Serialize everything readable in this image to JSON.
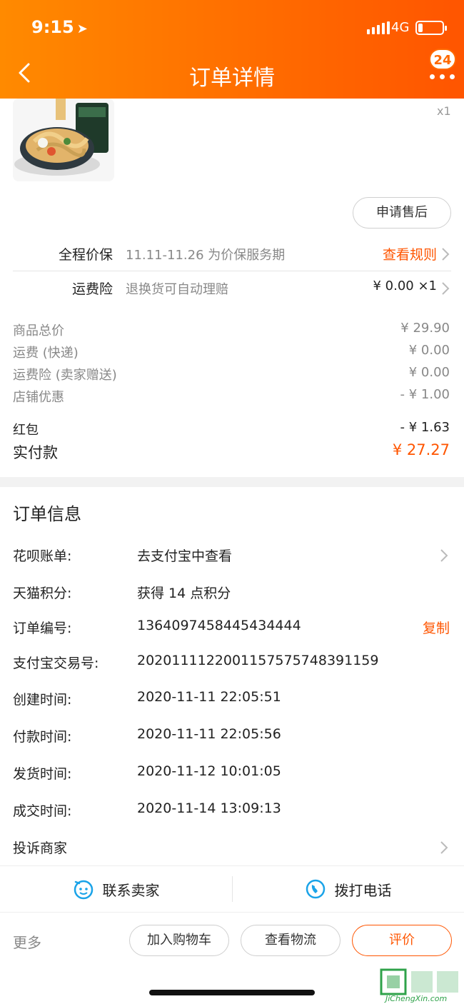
{
  "status_bar": {
    "time": "9:15",
    "network": "4G"
  },
  "header": {
    "title": "订单详情",
    "badge_count": "24"
  },
  "product": {
    "quantity": "x1",
    "after_sale_label": "申请售后"
  },
  "services": [
    {
      "label": "全程价保",
      "desc": "11.11-11.26 为价保服务期",
      "action": "查看规则"
    },
    {
      "label": "运费险",
      "desc": "退换货可自动理赔",
      "price": "¥ 0.00 ×1"
    }
  ],
  "prices": [
    {
      "label": "商品总价",
      "value": "¥ 29.90"
    },
    {
      "label": "运费 (快递)",
      "value": "¥ 0.00"
    },
    {
      "label": "运费险 (卖家赠送)",
      "value": "¥ 0.00"
    },
    {
      "label": "店铺优惠",
      "value": "- ¥ 1.00"
    },
    {
      "label": "红包",
      "value": "- ¥ 1.63"
    },
    {
      "label": "实付款",
      "value": "¥ 27.27"
    }
  ],
  "order_info": {
    "title": "订单信息",
    "rows": [
      {
        "key": "花呗账单:",
        "value": "去支付宝中查看"
      },
      {
        "key": "天猫积分:",
        "value": "获得 14 点积分"
      },
      {
        "key": "订单编号:",
        "value": "1364097458445434444",
        "action": "复制"
      },
      {
        "key": "支付宝交易号:",
        "value": "2020111122001157575748391159"
      },
      {
        "key": "创建时间:",
        "value": "2020-11-11 22:05:51"
      },
      {
        "key": "付款时间:",
        "value": "2020-11-11 22:05:56"
      },
      {
        "key": "发货时间:",
        "value": "2020-11-12 10:01:05"
      },
      {
        "key": "成交时间:",
        "value": "2020-11-14 13:09:13"
      }
    ],
    "complaint": "投诉商家"
  },
  "contact": {
    "seller": "联系卖家",
    "phone": "拨打电话"
  },
  "bottom_bar": {
    "more": "更多",
    "add_cart": "加入购物车",
    "logistics": "查看物流",
    "review": "评价"
  },
  "watermark": {
    "text": "JiChengXin.com"
  },
  "colors": {
    "accent": "#ff5500",
    "header_start": "#ff8a00",
    "header_end": "#ff5500",
    "contact_icon": "#1aa3e8"
  }
}
